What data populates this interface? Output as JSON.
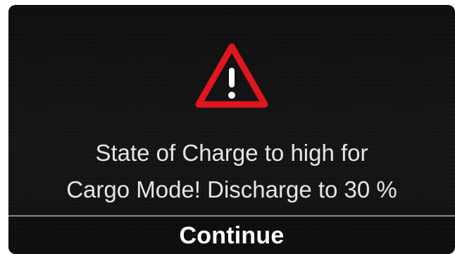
{
  "dialog": {
    "icon": "warning-triangle-icon",
    "message_lines": [
      "State of Charge to high for",
      "Cargo Mode! Discharge to 30 %"
    ],
    "continue_label": "Continue"
  },
  "colors": {
    "background": "#121212",
    "warning_red": "#e0161f",
    "text": "#e6e6e6",
    "divider": "#8a8a8a"
  }
}
